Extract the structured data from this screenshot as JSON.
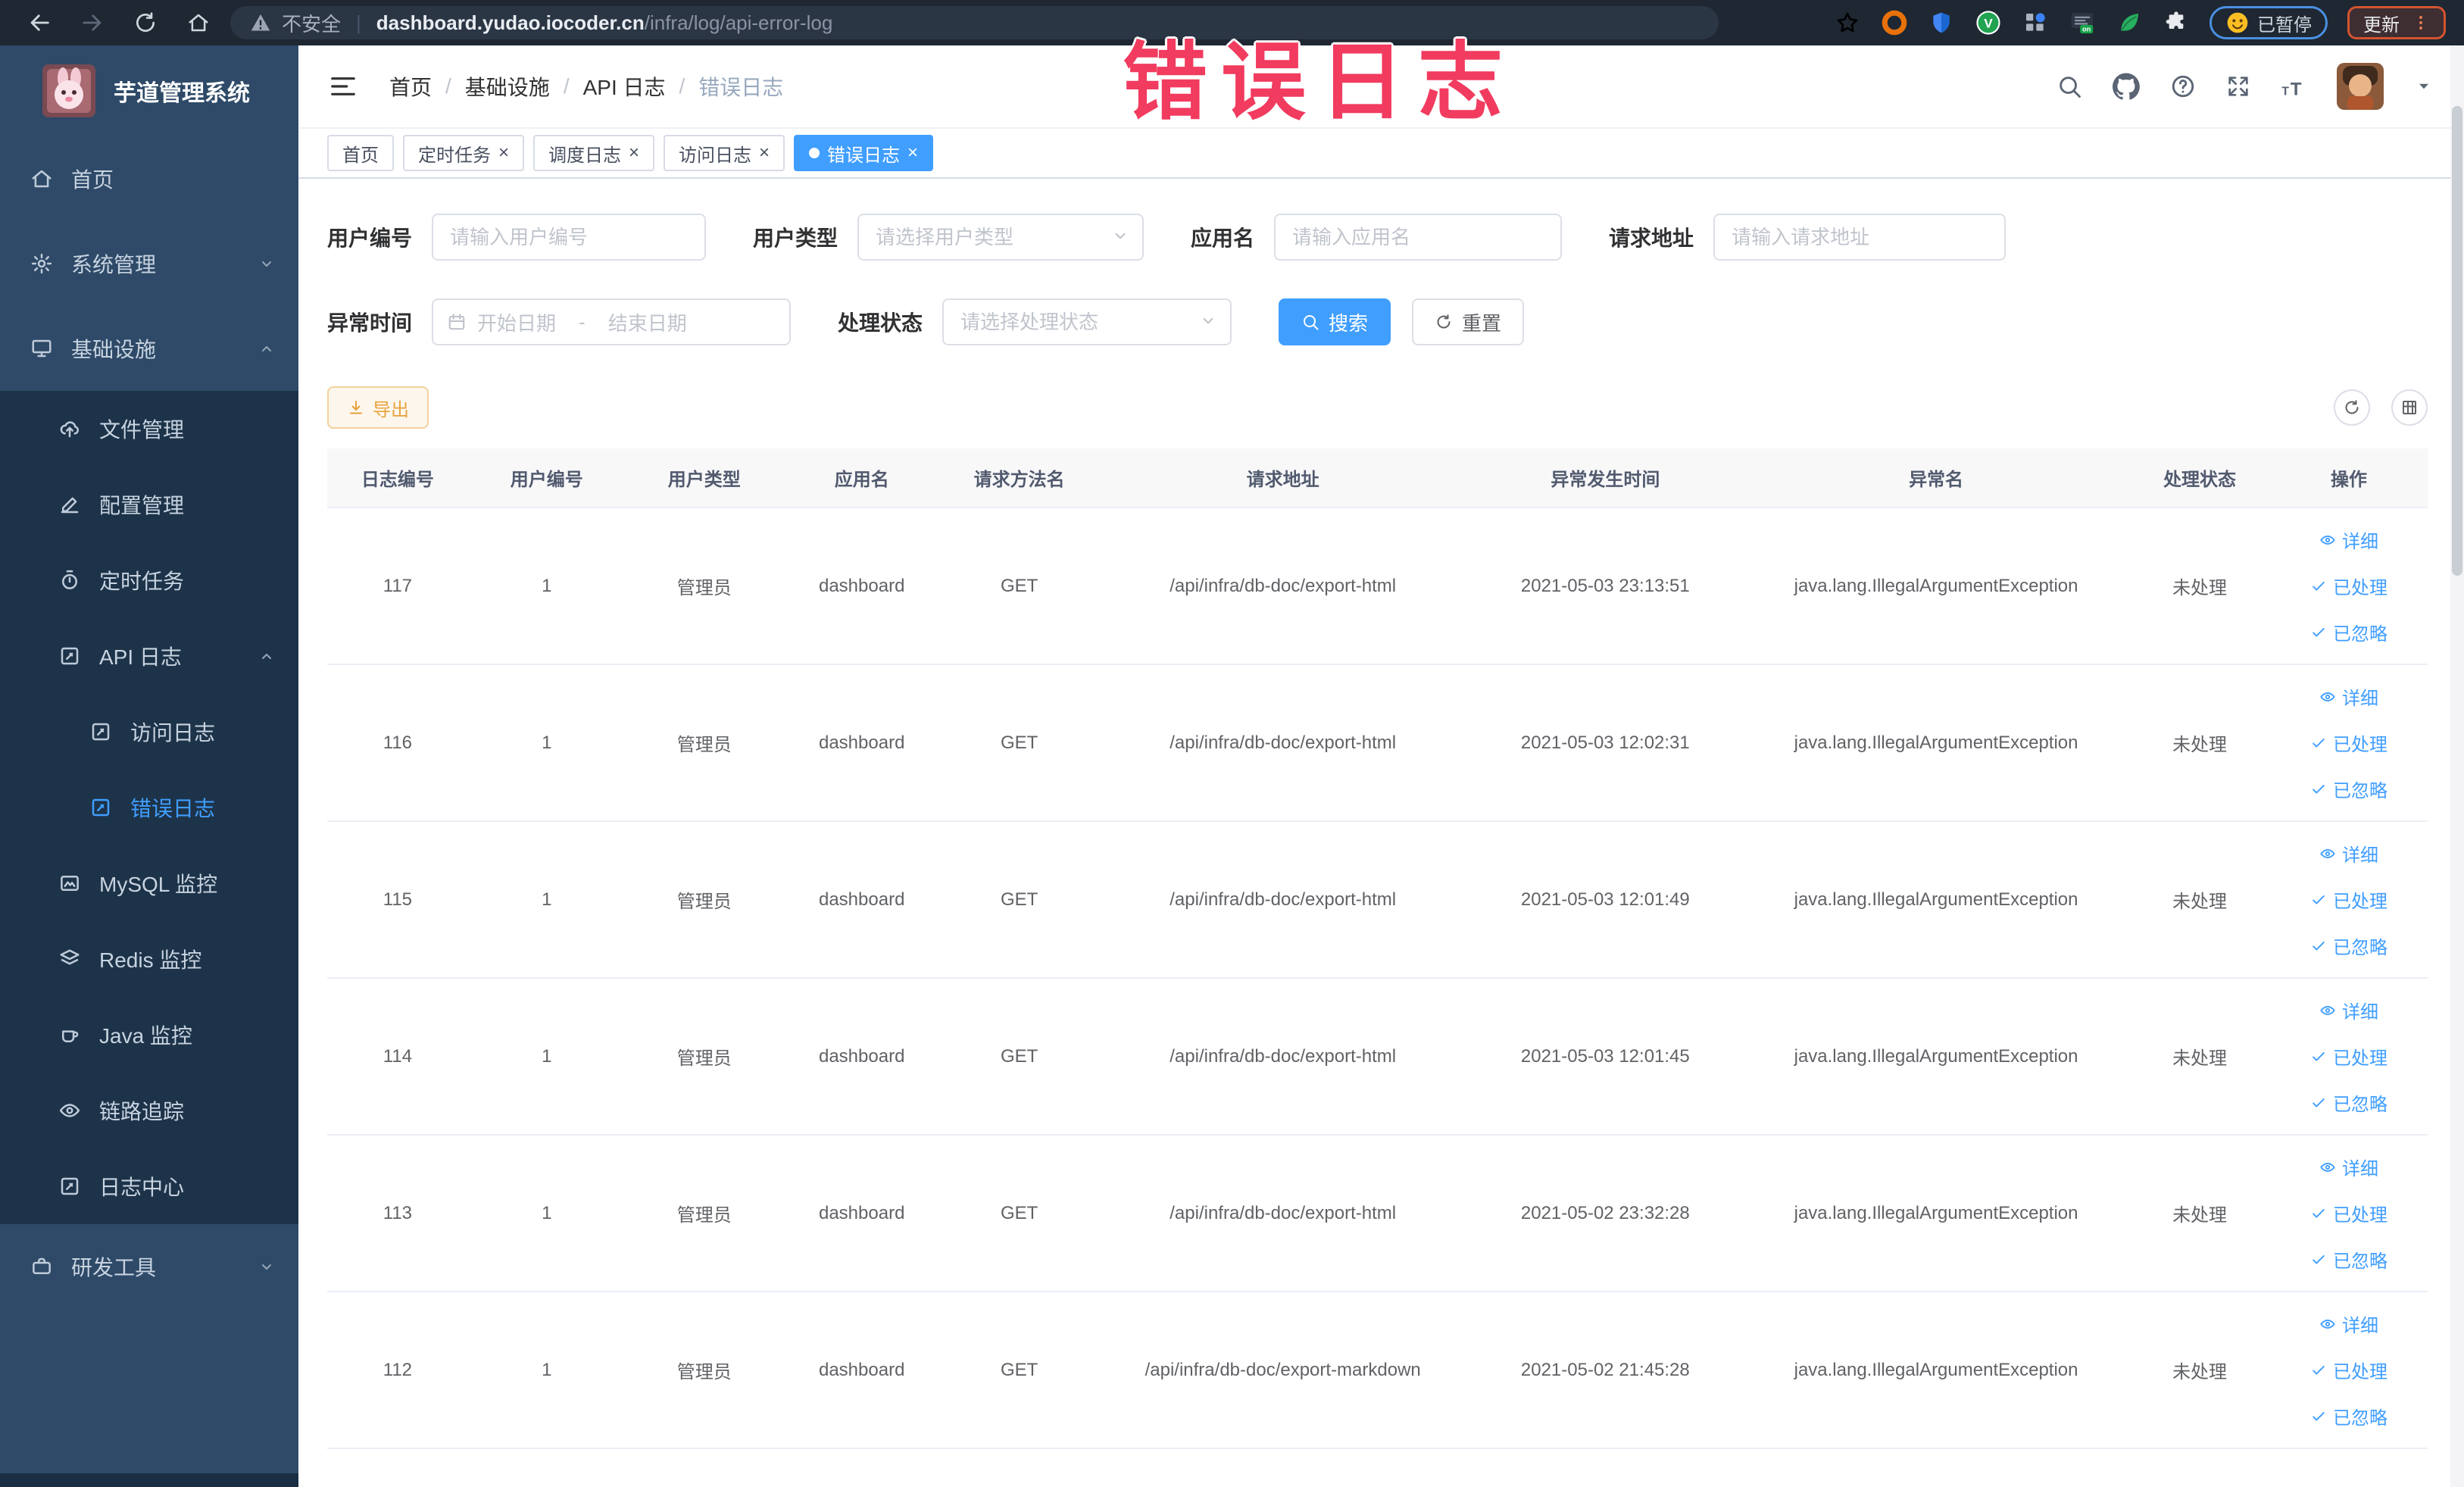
{
  "browser": {
    "security_label": "不安全",
    "url_domain": "dashboard.yudao.iocoder.cn",
    "url_path": "/infra/log/api-error-log",
    "paused_badge": "已暂停",
    "update_badge": "更新"
  },
  "overlay": {
    "title": "错误日志"
  },
  "sidebar": {
    "app_title": "芋道管理系统",
    "items": [
      {
        "name": "home",
        "label": "首页",
        "icon": "home",
        "level": 0
      },
      {
        "name": "system-mgmt",
        "label": "系统管理",
        "icon": "gear",
        "level": 0,
        "chevron": "down"
      },
      {
        "name": "infrastructure",
        "label": "基础设施",
        "icon": "monitor",
        "level": 0,
        "chevron": "up"
      },
      {
        "name": "file-mgmt",
        "label": "文件管理",
        "icon": "cloud",
        "level": 1,
        "sub": true
      },
      {
        "name": "config-mgmt",
        "label": "配置管理",
        "icon": "edit",
        "level": 1,
        "sub": true
      },
      {
        "name": "scheduled-jobs",
        "label": "定时任务",
        "icon": "timer",
        "level": 1,
        "sub": true
      },
      {
        "name": "api-logs",
        "label": "API 日志",
        "icon": "doc",
        "level": 1,
        "sub": true,
        "chevron": "up"
      },
      {
        "name": "access-log",
        "label": "访问日志",
        "icon": "doc",
        "level": 2,
        "sub": true
      },
      {
        "name": "error-log",
        "label": "错误日志",
        "icon": "doc",
        "level": 2,
        "sub": true,
        "active": true
      },
      {
        "name": "mysql-monitor",
        "label": "MySQL 监控",
        "icon": "db",
        "level": 1,
        "sub": true
      },
      {
        "name": "redis-monitor",
        "label": "Redis 监控",
        "icon": "layers",
        "level": 1,
        "sub": true
      },
      {
        "name": "java-monitor",
        "label": "Java 监控",
        "icon": "coffee",
        "level": 1,
        "sub": true
      },
      {
        "name": "tracing",
        "label": "链路追踪",
        "icon": "eye",
        "level": 1,
        "sub": true
      },
      {
        "name": "log-center",
        "label": "日志中心",
        "icon": "doc",
        "level": 1,
        "sub": true
      },
      {
        "name": "dev-tools",
        "label": "研发工具",
        "icon": "briefcase",
        "level": 0,
        "chevron": "down"
      }
    ]
  },
  "breadcrumb": [
    "首页",
    "基础设施",
    "API 日志",
    "错误日志"
  ],
  "tabs": [
    {
      "label": "首页",
      "closable": false,
      "active": false
    },
    {
      "label": "定时任务",
      "closable": true,
      "active": false
    },
    {
      "label": "调度日志",
      "closable": true,
      "active": false
    },
    {
      "label": "访问日志",
      "closable": true,
      "active": false
    },
    {
      "label": "错误日志",
      "closable": true,
      "active": true
    }
  ],
  "filters": {
    "user_id_label": "用户编号",
    "user_id_placeholder": "请输入用户编号",
    "user_type_label": "用户类型",
    "user_type_placeholder": "请选择用户类型",
    "app_name_label": "应用名",
    "app_name_placeholder": "请输入应用名",
    "request_url_label": "请求地址",
    "request_url_placeholder": "请输入请求地址",
    "exception_time_label": "异常时间",
    "start_date_placeholder": "开始日期",
    "date_separator": "-",
    "end_date_placeholder": "结束日期",
    "process_status_label": "处理状态",
    "process_status_placeholder": "请选择处理状态",
    "search_button": "搜索",
    "reset_button": "重置"
  },
  "toolbar": {
    "export_button": "导出"
  },
  "table": {
    "headers": [
      "日志编号",
      "用户编号",
      "用户类型",
      "应用名",
      "请求方法名",
      "请求地址",
      "异常发生时间",
      "异常名",
      "处理状态",
      "操作"
    ],
    "actions": [
      {
        "label": "详细",
        "icon": "eyeS"
      },
      {
        "label": "已处理",
        "icon": "check"
      },
      {
        "label": "已忽略",
        "icon": "check"
      }
    ],
    "rows": [
      {
        "id": "117",
        "user_id": "1",
        "user_type": "管理员",
        "app": "dashboard",
        "method": "GET",
        "url": "/api/infra/db-doc/export-html",
        "time": "2021-05-03 23:13:51",
        "exception": "java.lang.IllegalArgumentException",
        "status": "未处理"
      },
      {
        "id": "116",
        "user_id": "1",
        "user_type": "管理员",
        "app": "dashboard",
        "method": "GET",
        "url": "/api/infra/db-doc/export-html",
        "time": "2021-05-03 12:02:31",
        "exception": "java.lang.IllegalArgumentException",
        "status": "未处理"
      },
      {
        "id": "115",
        "user_id": "1",
        "user_type": "管理员",
        "app": "dashboard",
        "method": "GET",
        "url": "/api/infra/db-doc/export-html",
        "time": "2021-05-03 12:01:49",
        "exception": "java.lang.IllegalArgumentException",
        "status": "未处理"
      },
      {
        "id": "114",
        "user_id": "1",
        "user_type": "管理员",
        "app": "dashboard",
        "method": "GET",
        "url": "/api/infra/db-doc/export-html",
        "time": "2021-05-03 12:01:45",
        "exception": "java.lang.IllegalArgumentException",
        "status": "未处理"
      },
      {
        "id": "113",
        "user_id": "1",
        "user_type": "管理员",
        "app": "dashboard",
        "method": "GET",
        "url": "/api/infra/db-doc/export-html",
        "time": "2021-05-02 23:32:28",
        "exception": "java.lang.IllegalArgumentException",
        "status": "未处理"
      },
      {
        "id": "112",
        "user_id": "1",
        "user_type": "管理员",
        "app": "dashboard",
        "method": "GET",
        "url": "/api/infra/db-doc/export-markdown",
        "time": "2021-05-02 21:45:28",
        "exception": "java.lang.IllegalArgumentException",
        "status": "未处理"
      }
    ]
  }
}
